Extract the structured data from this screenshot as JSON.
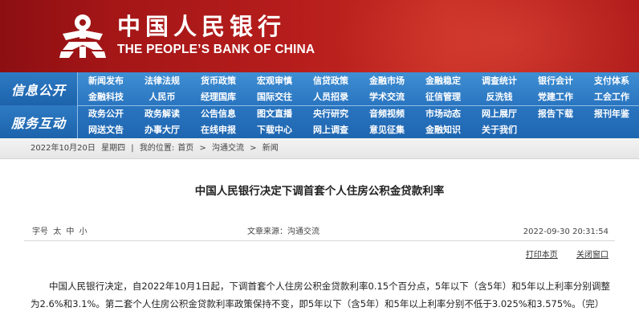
{
  "header": {
    "bank_name_cn": "中国人民银行",
    "bank_name_en": "THE PEOPLE’S BANK OF CHINA",
    "logo_icon": "pboc-emblem-icon",
    "colors": {
      "banner": "#b51d1c",
      "nav": "#2a75c0",
      "logo_white": "#ffffff"
    }
  },
  "nav": {
    "section_info": "信息公开",
    "section_service": "服务互动",
    "rows": [
      [
        "新闻发布",
        "法律法规",
        "货币政策",
        "宏观审慎",
        "信贷政策",
        "金融市场",
        "金融稳定",
        "调查统计",
        "银行会计",
        "支付体系"
      ],
      [
        "金融科技",
        "人民币",
        "经理国库",
        "国际交往",
        "人员招录",
        "学术交流",
        "征信管理",
        "反洗钱",
        "党建工作",
        "工会工作"
      ],
      [
        "政务公开",
        "政务解读",
        "公告信息",
        "图文直播",
        "央行研究",
        "音频视频",
        "市场动态",
        "网上展厅",
        "报告下载",
        "报刊年鉴"
      ],
      [
        "网送文告",
        "办事大厅",
        "在线申报",
        "下载中心",
        "网上调查",
        "意见征集",
        "金融知识",
        "关于我们"
      ]
    ]
  },
  "breadcrumb": {
    "date": "2022年10月20日",
    "weekday": "星期四",
    "sep": "|",
    "location_prefix": "我的位置:",
    "home": "首页",
    "arrow": ">",
    "level1": "沟通交流",
    "level2": "新闻"
  },
  "article": {
    "title": "中国人民银行决定下调首套个人住房公积金贷款利率",
    "font_size_label": "字号",
    "font_sizes": [
      "太",
      "中",
      "小"
    ],
    "source": "文章来源：沟通交流",
    "datetime": "2022-09-30  20:31:54",
    "print": "打印本页",
    "close": "关闭窗口",
    "body": "中国人民银行决定，自2022年10月1日起，下调首套个人住房公积金贷款利率0.15个百分点，5年以下（含5年）和5年以上利率分别调整为2.6%和3.1%。第二套个人住房公积金贷款利率政策保持不变，即5年以下（含5年）和5年以上利率分别不低于3.025%和3.575%。（完）"
  }
}
